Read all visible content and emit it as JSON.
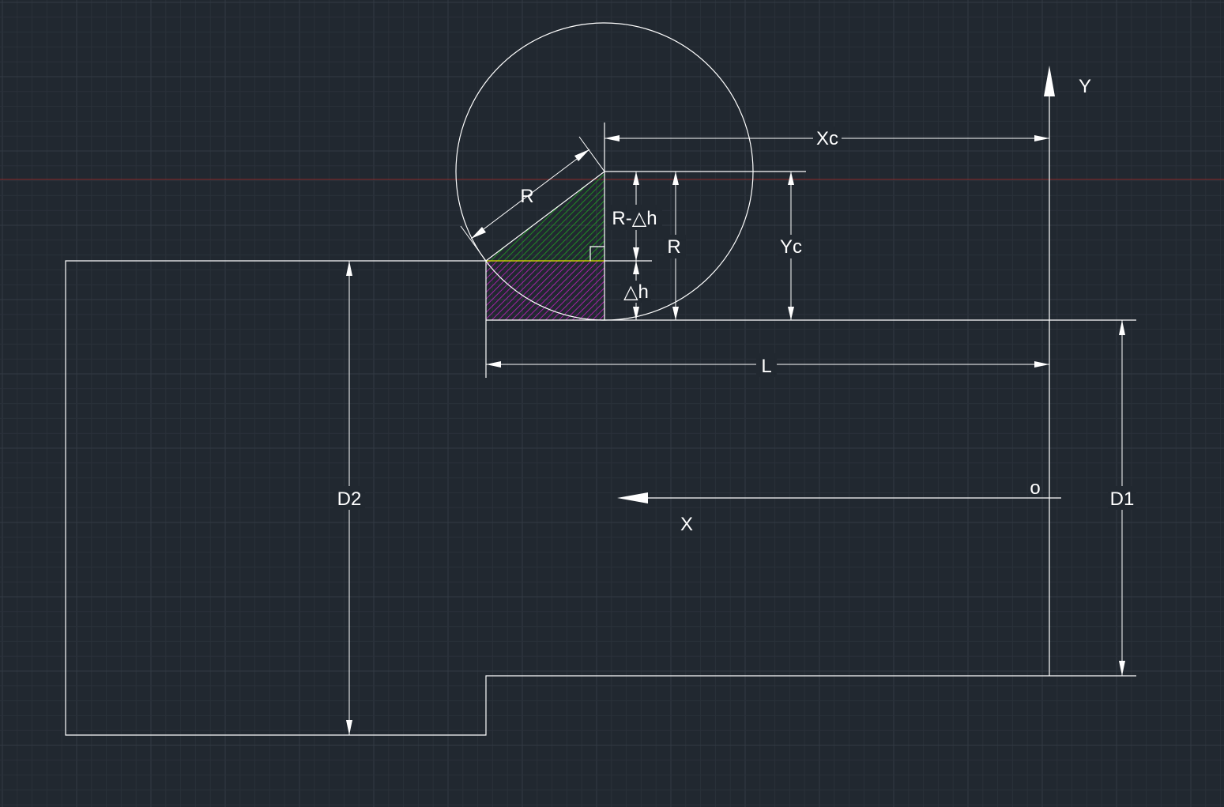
{
  "colors": {
    "background": "#212830",
    "grid_minor": "#2a313a",
    "grid_major": "#323a44",
    "line": "#ffffff",
    "crosshair": "#8a2a2a",
    "hatch_green": "#1fa81f",
    "hatch_magenta": "#c21ec2",
    "yellow_edge": "#e6e600"
  },
  "labels": {
    "radius_slant": "R",
    "r_minus_dh": "R-△h",
    "radius_vertical": "R",
    "delta_h": "△h",
    "xc": "Xc",
    "yc": "Yc",
    "l": "L",
    "d1": "D1",
    "d2": "D2",
    "axis_x": "X",
    "axis_y": "Y",
    "origin": "o"
  }
}
